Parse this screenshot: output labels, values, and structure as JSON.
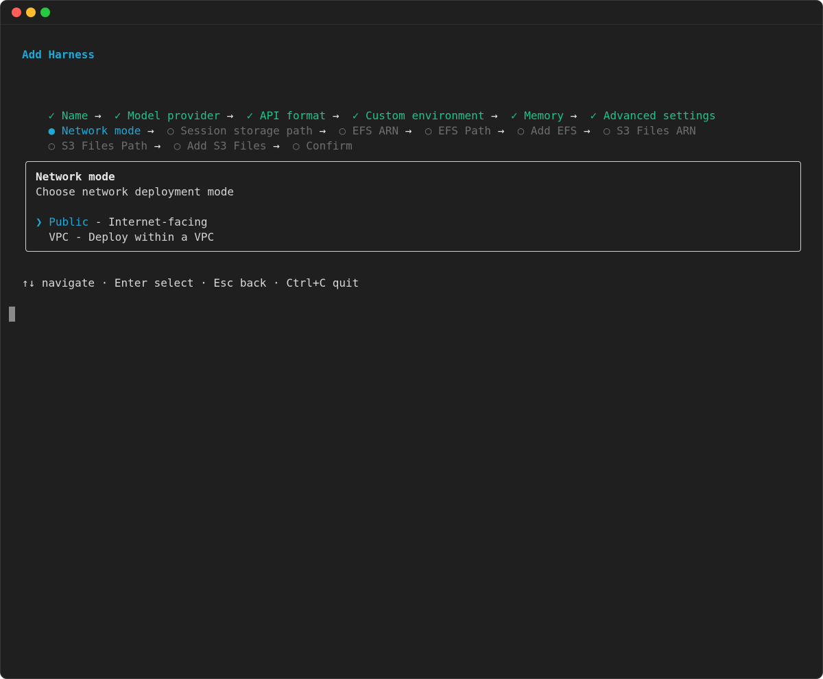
{
  "app_title": "Add Harness",
  "steps": [
    {
      "label": "Name",
      "state": "done",
      "marker": "✓"
    },
    {
      "label": "Model provider",
      "state": "done",
      "marker": "✓"
    },
    {
      "label": "API format",
      "state": "done",
      "marker": "✓"
    },
    {
      "label": "Custom environment",
      "state": "done",
      "marker": "✓"
    },
    {
      "label": "Memory",
      "state": "done",
      "marker": "✓"
    },
    {
      "label": "Advanced settings",
      "state": "done",
      "marker": "✓"
    },
    {
      "label": "Network mode",
      "state": "active",
      "marker": "●"
    },
    {
      "label": "Session storage path",
      "state": "pending",
      "marker": "○"
    },
    {
      "label": "EFS ARN",
      "state": "pending",
      "marker": "○"
    },
    {
      "label": "EFS Path",
      "state": "pending",
      "marker": "○"
    },
    {
      "label": "Add EFS",
      "state": "pending",
      "marker": "○"
    },
    {
      "label": "S3 Files ARN",
      "state": "pending",
      "marker": "○"
    },
    {
      "label": "S3 Files Path",
      "state": "pending",
      "marker": "○"
    },
    {
      "label": "Add S3 Files",
      "state": "pending",
      "marker": "○"
    },
    {
      "label": "Confirm",
      "state": "pending",
      "marker": "○"
    }
  ],
  "step_separator": "→",
  "panel": {
    "title": "Network mode",
    "subtitle": "Choose network deployment mode",
    "options": [
      {
        "pointer": "❯",
        "name": "Public",
        "description": " - Internet-facing",
        "selected": true
      },
      {
        "pointer": " ",
        "name": "VPC",
        "description": " - Deploy within a VPC",
        "selected": false
      }
    ]
  },
  "help_text": "↑↓ navigate · Enter select · Esc back · Ctrl+C quit",
  "colors": {
    "background": "#1f1f1f",
    "accent": "#1fa8d6",
    "done": "#22c08a",
    "pending": "#6e6e6e"
  }
}
